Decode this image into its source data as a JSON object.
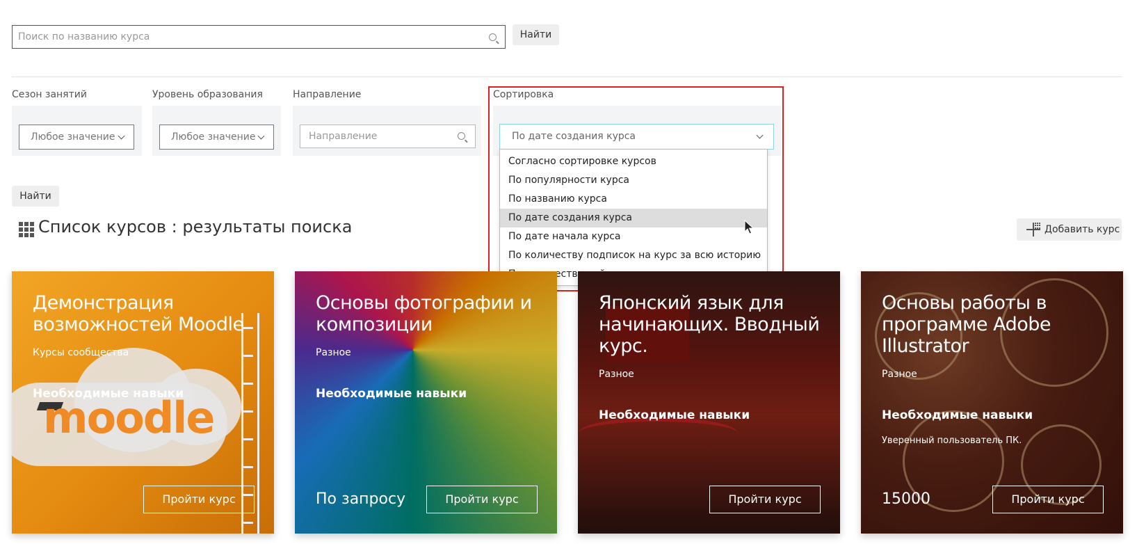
{
  "top_search": {
    "placeholder": "Поиск по названию курса",
    "button": "Найти"
  },
  "filters": {
    "season": {
      "label": "Сезон занятий",
      "value": "Любое значение"
    },
    "level": {
      "label": "Уровень образования",
      "value": "Любое значение"
    },
    "direction": {
      "label": "Направление",
      "placeholder": "Направление"
    },
    "sort": {
      "label": "Сортировка",
      "value": "По дате создания курса",
      "options": [
        "Согласно сортировке курсов",
        "По популярности курса",
        "По названию курса",
        "По дате создания курса",
        "По дате начала курса",
        "По количеству подписок на курс за всю историю",
        "По количеству действующих подписок на курс"
      ]
    },
    "find_button": "Найти"
  },
  "list": {
    "title": "Список курсов : результаты поиска",
    "add_button": "Добавить курс"
  },
  "courses": [
    {
      "title": "Демонстрация возможностей Moodle",
      "category": "Курсы сообщества",
      "skills_label": "Необходимые навыки",
      "skills": "",
      "price": "",
      "button": "Пройти курс",
      "logo_text": "moodle"
    },
    {
      "title": "Основы фотографии и композиции",
      "category": "Разное",
      "skills_label": "Необходимые навыки",
      "skills": "",
      "price": "По запросу",
      "button": "Пройти курс"
    },
    {
      "title": "Японский язык для начинающих. Вводный курс.",
      "category": "Разное",
      "skills_label": "Необходимые навыки",
      "skills": "",
      "price": "",
      "button": "Пройти курс"
    },
    {
      "title": "Основы работы в программе Adobe Illustrator",
      "category": "Разное",
      "skills_label": "Необходимые навыки",
      "skills": "Уверенный пользователь ПК.",
      "price": "15000",
      "button": "Пройти курс"
    }
  ]
}
